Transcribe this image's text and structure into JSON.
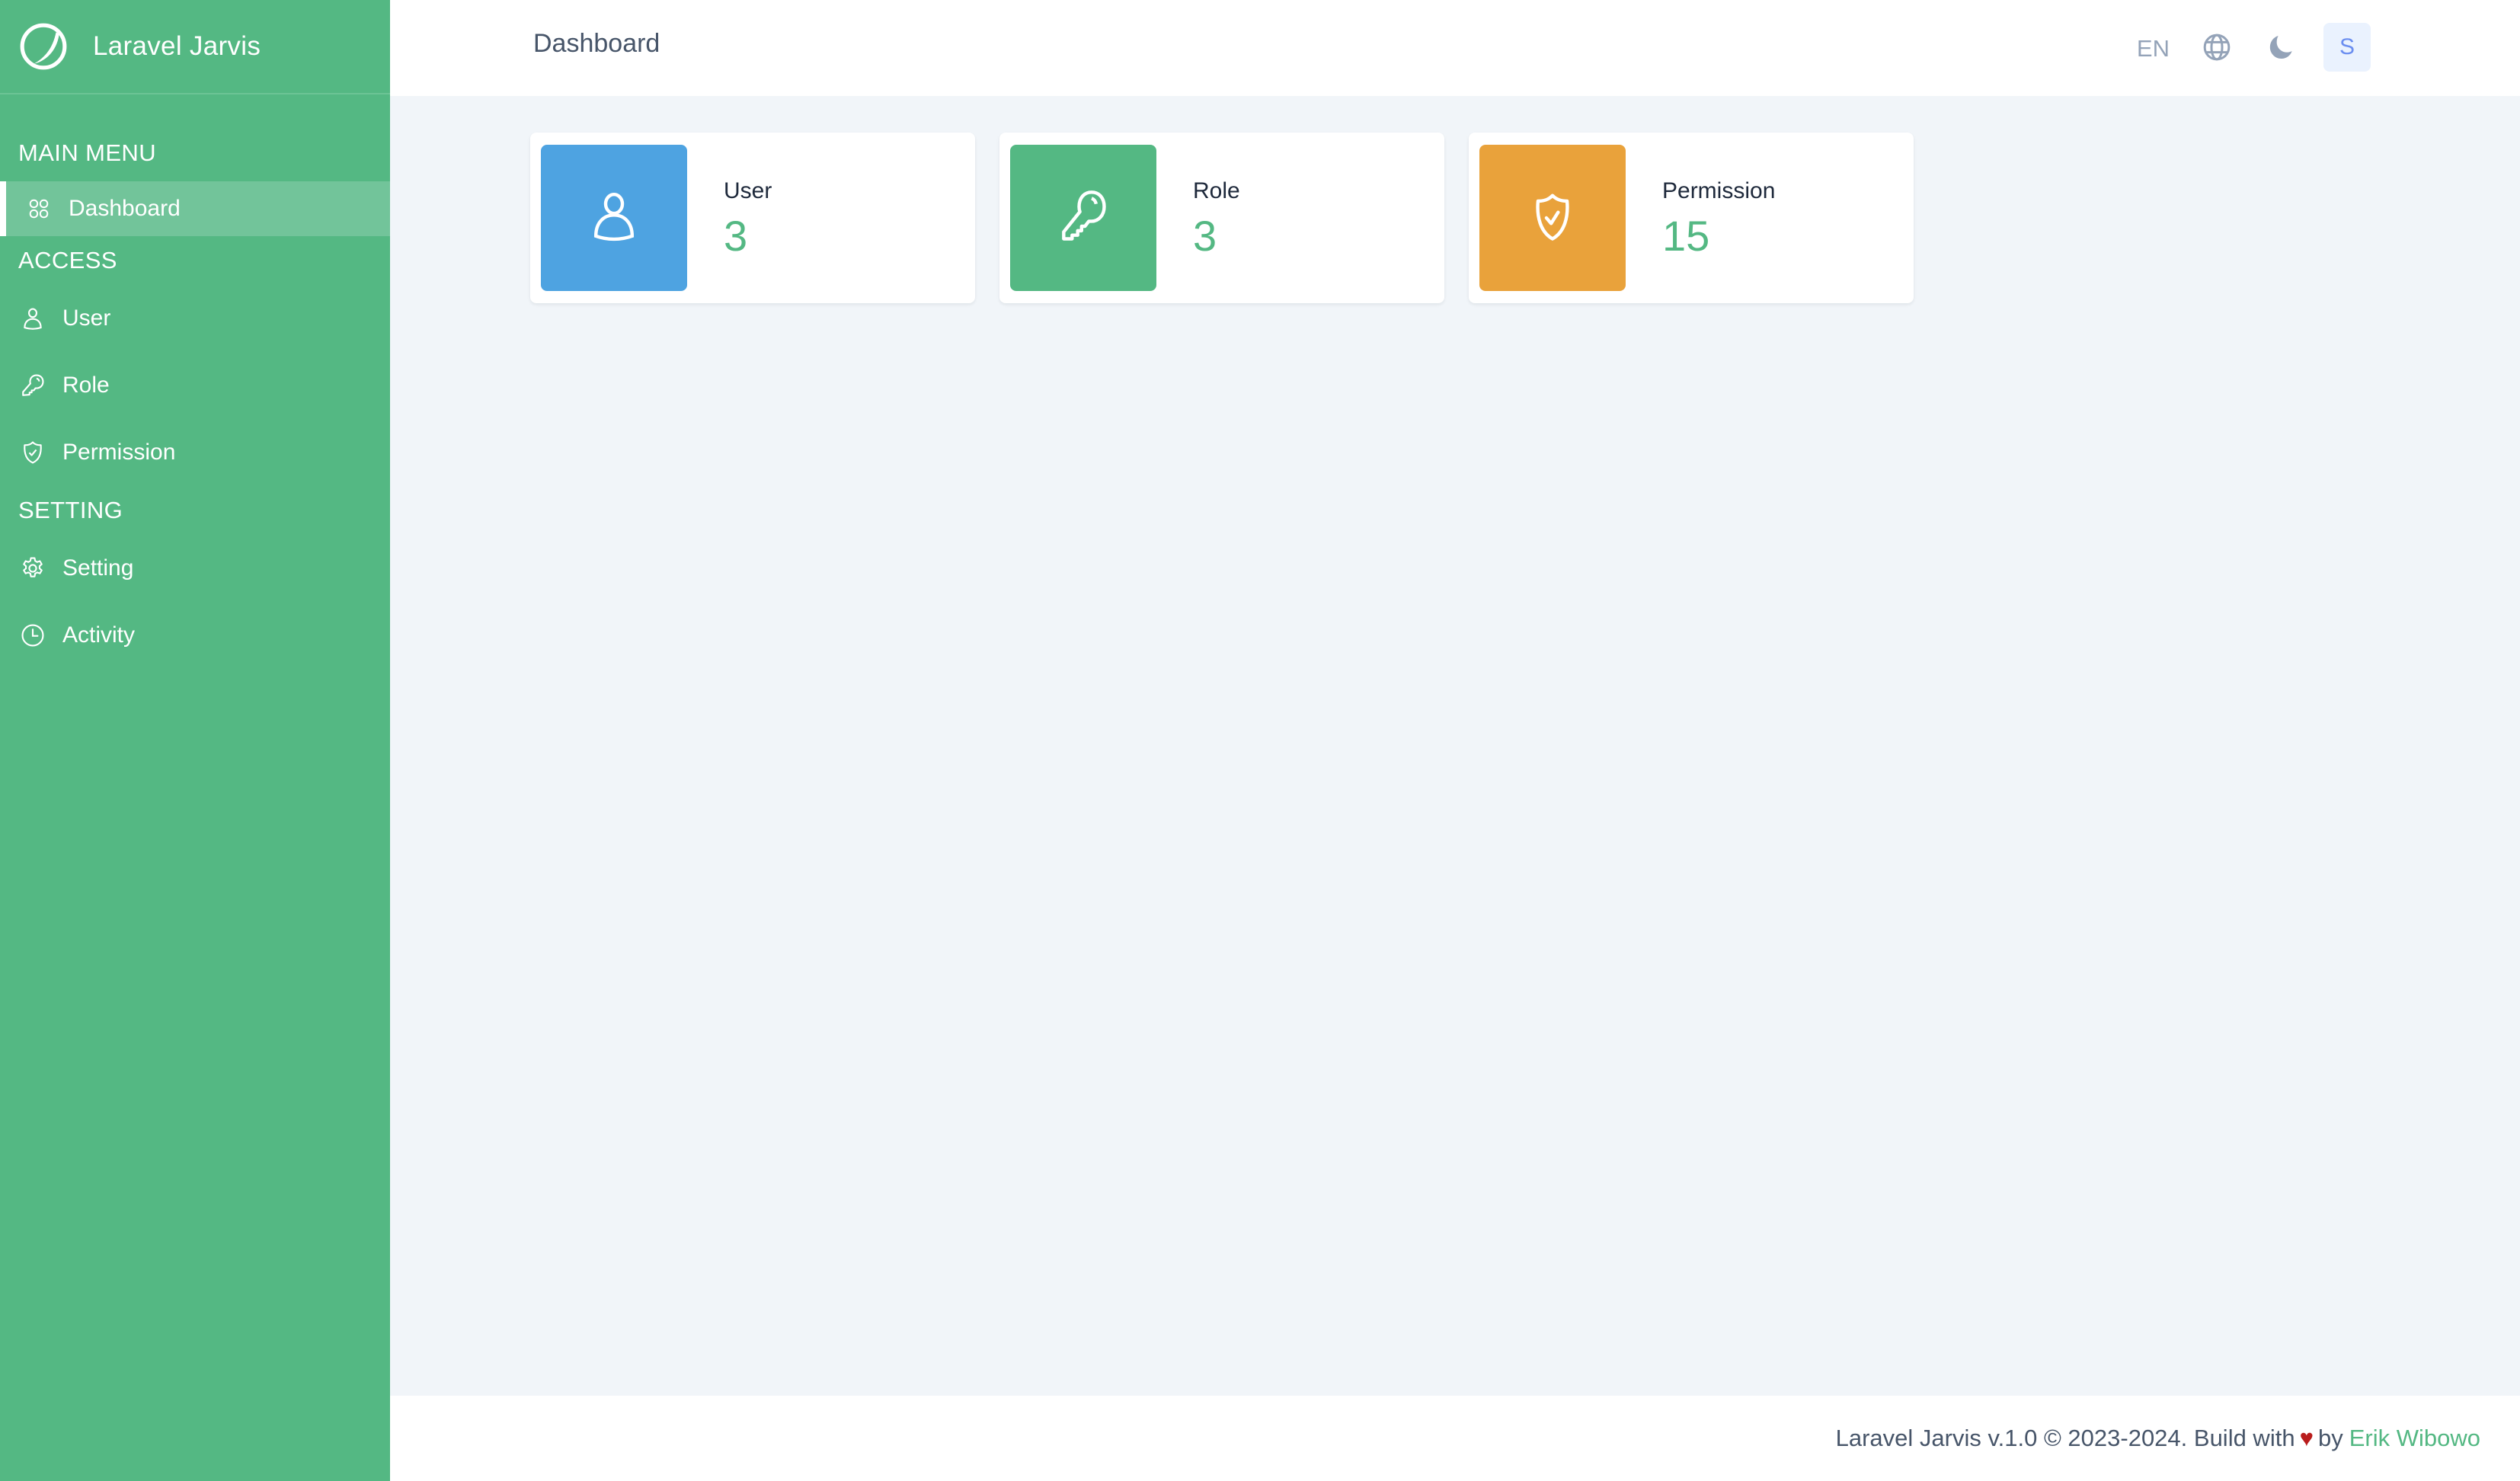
{
  "app": {
    "title": "Laravel Jarvis"
  },
  "colors": {
    "primary": "#54b883",
    "user_card": "#4ea3e1",
    "role_card": "#54b883",
    "permission_card": "#e9a23b"
  },
  "sidebar": {
    "sections": [
      {
        "title": "MAIN MENU",
        "items": [
          {
            "label": "Dashboard",
            "icon": "grid-icon",
            "active": true
          }
        ]
      },
      {
        "title": "ACCESS",
        "items": [
          {
            "label": "User",
            "icon": "user-icon"
          },
          {
            "label": "Role",
            "icon": "key-icon"
          },
          {
            "label": "Permission",
            "icon": "shield-check-icon"
          }
        ]
      },
      {
        "title": "SETTING",
        "items": [
          {
            "label": "Setting",
            "icon": "gear-icon"
          },
          {
            "label": "Activity",
            "icon": "clock-icon"
          }
        ]
      }
    ]
  },
  "header": {
    "title": "Dashboard",
    "language": "EN",
    "avatar_initial": "S"
  },
  "cards": [
    {
      "label": "User",
      "value": "3",
      "icon": "user-icon"
    },
    {
      "label": "Role",
      "value": "3",
      "icon": "key-icon"
    },
    {
      "label": "Permission",
      "value": "15",
      "icon": "shield-check-icon"
    }
  ],
  "footer": {
    "text": "Laravel Jarvis v.1.0 © 2023-2024. Build with",
    "heart": "♥",
    "by": "by",
    "author": "Erik Wibowo"
  }
}
